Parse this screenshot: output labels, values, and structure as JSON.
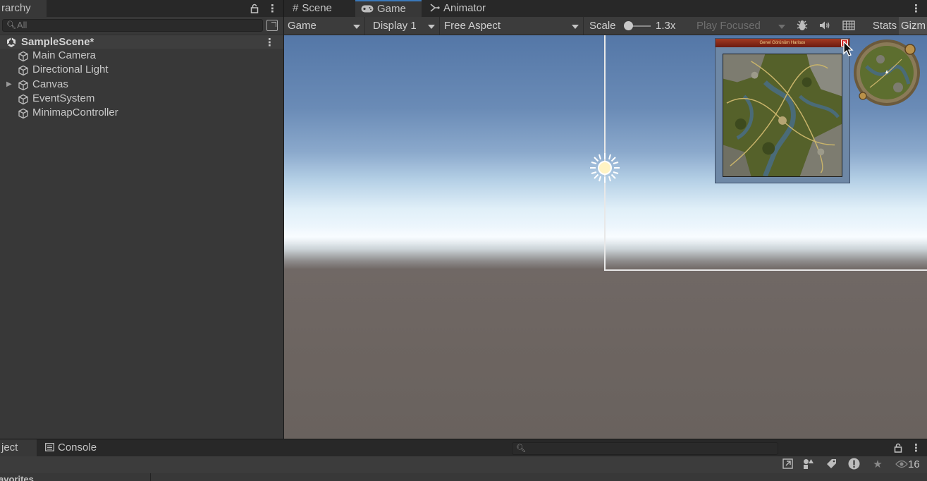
{
  "hierarchy": {
    "tab_label": "Hierarchy",
    "tab_visible": "rarchy",
    "search_placeholder": "All",
    "scene_name": "SampleScene*",
    "items": [
      {
        "label": "Main Camera",
        "expandable": false
      },
      {
        "label": "Directional Light",
        "expandable": false
      },
      {
        "label": "Canvas",
        "expandable": true
      },
      {
        "label": "EventSystem",
        "expandable": false
      },
      {
        "label": "MinimapController",
        "expandable": false
      }
    ]
  },
  "view_tabs": {
    "scene": "Scene",
    "game": "Game",
    "animator": "Animator",
    "active": "Game"
  },
  "game_toolbar": {
    "view_select": "Game",
    "display_select": "Display 1",
    "aspect_select": "Free Aspect",
    "scale_label": "Scale",
    "scale_value": "1.3x",
    "play_mode_select": "Play Focused",
    "stats_label": "Stats",
    "gizmos_label": "Gizmos",
    "gizmos_visible": "Gizm"
  },
  "game_view": {
    "map_window_title": "Genel Görünüm Haritası",
    "map_close_glyph": "×"
  },
  "bottom_panel": {
    "project_tab": "Project",
    "project_tab_visible": "ject",
    "console_tab": "Console",
    "favorites_label": "Favorites",
    "favorites_visible": "avorites",
    "visibility_count": "16"
  },
  "colors": {
    "accent": "#3a79bb",
    "panel_bg": "#383838",
    "tab_bar_bg": "#282828",
    "close_red": "#d62b2b"
  }
}
